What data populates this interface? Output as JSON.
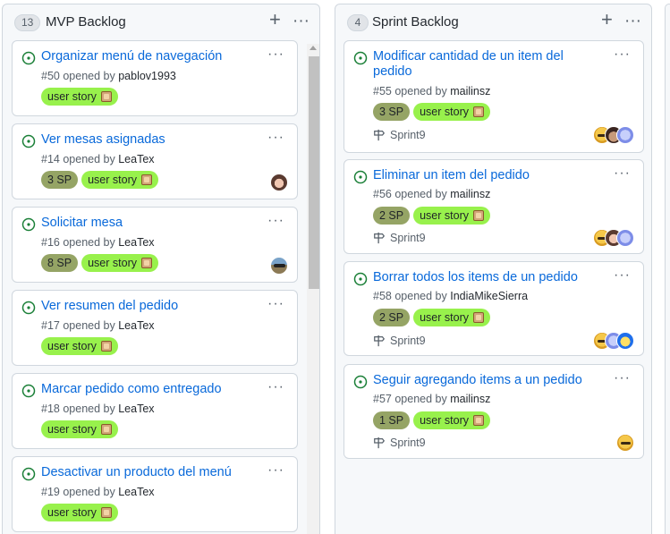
{
  "columns": [
    {
      "count": "13",
      "title": "MVP Backlog",
      "cards": [
        {
          "title": "Organizar menú de navegación",
          "number": "#50",
          "opened_by": "opened by",
          "author": "pablov1993",
          "sp": "",
          "label": "user story"
        },
        {
          "title": "Ver mesas asignadas",
          "number": "#14",
          "opened_by": "opened by",
          "author": "LeaTex",
          "sp": "3 SP",
          "label": "user story"
        },
        {
          "title": "Solicitar mesa",
          "number": "#16",
          "opened_by": "opened by",
          "author": "LeaTex",
          "sp": "8 SP",
          "label": "user story"
        },
        {
          "title": "Ver resumen del pedido",
          "number": "#17",
          "opened_by": "opened by",
          "author": "LeaTex",
          "sp": "",
          "label": "user story"
        },
        {
          "title": "Marcar pedido como entregado",
          "number": "#18",
          "opened_by": "opened by",
          "author": "LeaTex",
          "sp": "",
          "label": "user story"
        },
        {
          "title": "Desactivar un producto del menú",
          "number": "#19",
          "opened_by": "opened by",
          "author": "LeaTex",
          "sp": "",
          "label": "user story"
        }
      ]
    },
    {
      "count": "4",
      "title": "Sprint Backlog",
      "cards": [
        {
          "title": "Modificar cantidad de un item del pedido",
          "number": "#55",
          "opened_by": "opened by",
          "author": "mailinsz",
          "sp": "3 SP",
          "label": "user story",
          "milestone": "Sprint9"
        },
        {
          "title": "Eliminar un item del pedido",
          "number": "#56",
          "opened_by": "opened by",
          "author": "mailinsz",
          "sp": "2 SP",
          "label": "user story",
          "milestone": "Sprint9"
        },
        {
          "title": "Borrar todos los items de un pedido",
          "number": "#58",
          "opened_by": "opened by",
          "author": "IndiaMikeSierra",
          "sp": "2 SP",
          "label": "user story",
          "milestone": "Sprint9"
        },
        {
          "title": "Seguir agregando items a un pedido",
          "number": "#57",
          "opened_by": "opened by",
          "author": "mailinsz",
          "sp": "1 SP",
          "label": "user story",
          "milestone": "Sprint9"
        }
      ]
    }
  ],
  "icons": {
    "open_issue": "issue-opened-icon",
    "milestone": "milestone-icon",
    "more": "kebab-horizontal-icon",
    "add": "plus-icon",
    "label_emoji": "package-emoji-icon"
  },
  "colors": {
    "link": "#0969da",
    "open_icon": "#1a7f37",
    "label_story": "#98f14c",
    "label_sp": "#95a465"
  },
  "symbols": {
    "plus": "+",
    "dots": "···"
  }
}
